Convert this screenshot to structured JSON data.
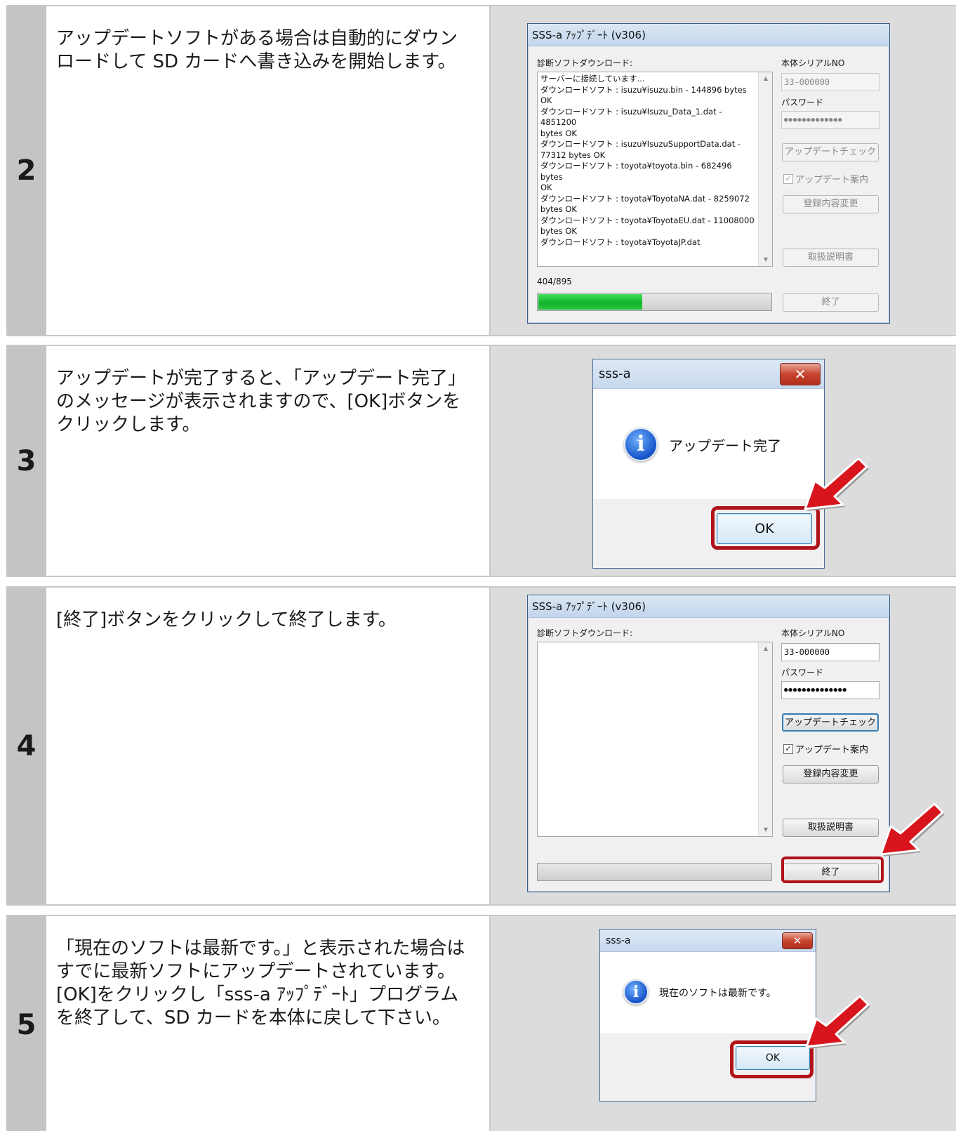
{
  "steps": [
    {
      "number": "2",
      "text": "アップデートソフトがある場合は自動的にダウン\nロードして SD カードへ書き込みを開始します。"
    },
    {
      "number": "3",
      "text": "アップデートが完了すると、「アップデート完了」\nのメッセージが表示されますので、[OK]ボタンを\nクリックします。"
    },
    {
      "number": "4",
      "text": " [終了]ボタンをクリックして終了します。"
    },
    {
      "number": "5",
      "text": "「現在のソフトは最新です。」と表示された場合は\nすでに最新ソフトにアップデートされています。\n[OK]をクリックし「sss-a ｱｯﾌﾟﾃﾞｰﾄ」プログラム\nを終了して、SD カードを本体に戻して下さい。"
    }
  ],
  "updater_window": {
    "title": "SSS-a ｱｯﾌﾟﾃﾞｰﾄ (v306)",
    "download_label": "診断ソフトダウンロード:",
    "serial_label": "本体シリアルNO",
    "serial_value": "33-000000",
    "password_label": "パスワード",
    "password_mask_step2": "●●●●●●●●●●●●●",
    "password_mask_step4": "●●●●●●●●●●●●●●",
    "check_button": "アップデートチェック",
    "notify_checkbox": "アップデート案内",
    "edit_button": "登録内容変更",
    "manual_button": "取扱説明書",
    "exit_button": "終了",
    "log_lines": [
      "サーバーに接続しています...",
      "ダウンロードソフト : isuzu¥isuzu.bin - 144896 bytes OK",
      "ダウンロードソフト : isuzu¥Isuzu_Data_1.dat - 4851200",
      "bytes OK",
      "ダウンロードソフト : isuzu¥IsuzuSupportData.dat -",
      "77312 bytes OK",
      "ダウンロードソフト : toyota¥toyota.bin - 682496 bytes",
      "OK",
      "ダウンロードソフト : toyota¥ToyotaNA.dat - 8259072",
      "bytes OK",
      "ダウンロードソフト : toyota¥ToyotaEU.dat - 11008000",
      "bytes OK",
      "ダウンロードソフト : toyota¥ToyotaJP.dat"
    ],
    "progress_text": "404/895",
    "progress_fraction": 0.4514
  },
  "message_complete": {
    "title": "sss-a",
    "message": "アップデート完了",
    "ok": "OK",
    "close": "✕"
  },
  "message_latest": {
    "title": "sss-a",
    "message": "現在のソフトは最新です。",
    "ok": "OK",
    "close": "✕"
  },
  "colors": {
    "progress_green": "#1fcc3a",
    "highlight_red": "#b1121a",
    "arrow_red": "#d8141c",
    "row_number_bg": "#c4c4c4",
    "screenshot_bg": "#dcdcdc"
  }
}
